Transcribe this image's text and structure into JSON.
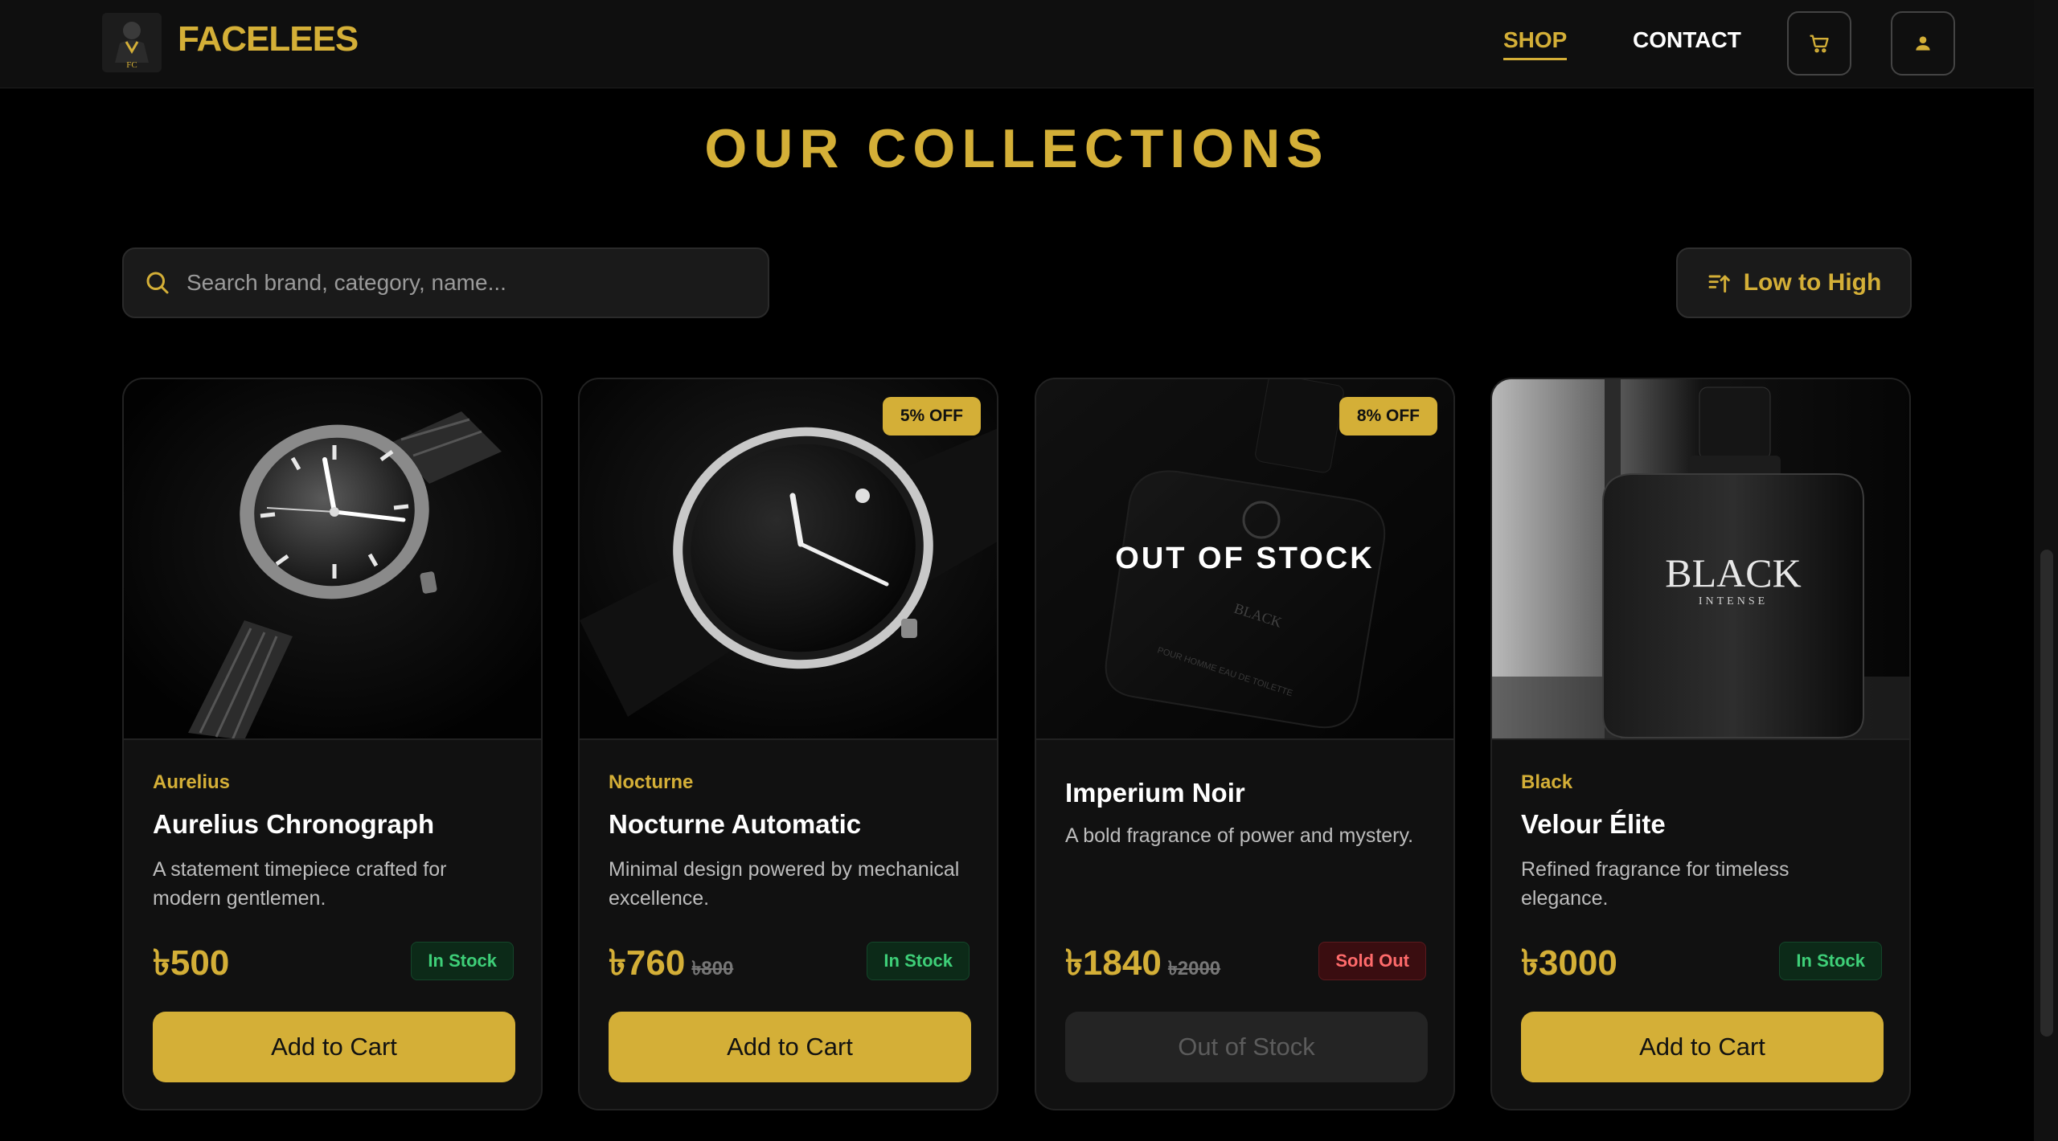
{
  "brand": {
    "name": "FACELEES"
  },
  "nav": {
    "shop": "SHOP",
    "contact": "CONTACT"
  },
  "page": {
    "title": "OUR COLLECTIONS"
  },
  "search": {
    "placeholder": "Search brand, category, name..."
  },
  "sort": {
    "label": "Low to High"
  },
  "colors": {
    "accent": "#d4af37",
    "background": "#000000",
    "card": "#111111",
    "in_stock": "#3ecf78",
    "sold_out": "#ff6b6b"
  },
  "products": [
    {
      "brand": "Aurelius",
      "name": "Aurelius Chronograph",
      "description": "A statement timepiece crafted for modern gentlemen.",
      "price": "৳500",
      "old_price": "",
      "discount": "",
      "stock": "In Stock",
      "button": "Add to Cart"
    },
    {
      "brand": "Nocturne",
      "name": "Nocturne Automatic",
      "description": "Minimal design powered by mechanical excellence.",
      "price": "৳760",
      "old_price": "৳800",
      "discount": "5% OFF",
      "stock": "In Stock",
      "button": "Add to Cart"
    },
    {
      "brand": "",
      "name": "Imperium Noir",
      "description": "A bold fragrance of power and mystery.",
      "price": "৳1840",
      "old_price": "৳2000",
      "discount": "8% OFF",
      "stock": "Sold Out",
      "button": "Out of Stock",
      "overlay": "OUT OF STOCK"
    },
    {
      "brand": "Black",
      "name": "Velour Élite",
      "description": "Refined fragrance for timeless elegance.",
      "price": "৳3000",
      "old_price": "",
      "discount": "",
      "stock": "In Stock",
      "button": "Add to Cart"
    }
  ]
}
